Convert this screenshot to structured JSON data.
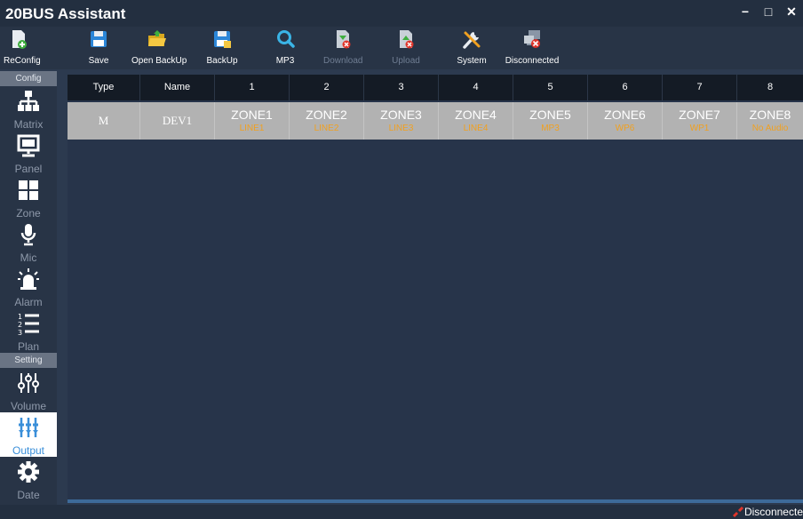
{
  "app": {
    "title": "20BUS Assistant"
  },
  "window": {
    "minimize": "−",
    "maximize": "□",
    "close": "✕"
  },
  "toolbar": {
    "items": [
      {
        "label": "ReConfig",
        "icon": "reconfig-icon",
        "enabled": true
      },
      {
        "label": "Save",
        "icon": "save-icon",
        "enabled": true
      },
      {
        "label": "Open BackUp",
        "icon": "folder-open-icon",
        "enabled": true
      },
      {
        "label": "BackUp",
        "icon": "backup-icon",
        "enabled": true
      },
      {
        "label": "MP3",
        "icon": "search-icon",
        "enabled": true
      },
      {
        "label": "Download",
        "icon": "download-icon",
        "enabled": false
      },
      {
        "label": "Upload",
        "icon": "upload-icon",
        "enabled": false
      },
      {
        "label": "System",
        "icon": "tools-icon",
        "enabled": true
      },
      {
        "label": "Disconnected",
        "icon": "disconnected-icon",
        "enabled": true
      }
    ]
  },
  "sidebar": {
    "config_header": "Config",
    "setting_header": "Setting",
    "items": [
      {
        "label": "Matrix",
        "icon": "matrix-icon"
      },
      {
        "label": "Panel",
        "icon": "panel-icon"
      },
      {
        "label": "Zone",
        "icon": "zone-icon"
      },
      {
        "label": "Mic",
        "icon": "mic-icon"
      },
      {
        "label": "Alarm",
        "icon": "alarm-icon"
      },
      {
        "label": "Plan",
        "icon": "plan-icon"
      },
      {
        "label": "Volume",
        "icon": "volume-icon"
      },
      {
        "label": "Output",
        "icon": "output-icon",
        "active": true
      },
      {
        "label": "Date",
        "icon": "gear-icon"
      }
    ]
  },
  "table": {
    "headers": [
      "Type",
      "Name",
      "1",
      "2",
      "3",
      "4",
      "5",
      "6",
      "7",
      "8"
    ],
    "row": {
      "type": "M",
      "name": "DEV1",
      "zones": [
        {
          "name": "ZONE1",
          "source": "LINE1"
        },
        {
          "name": "ZONE2",
          "source": "LINE2"
        },
        {
          "name": "ZONE3",
          "source": "LINE3"
        },
        {
          "name": "ZONE4",
          "source": "LINE4"
        },
        {
          "name": "ZONE5",
          "source": "MP3"
        },
        {
          "name": "ZONE6",
          "source": "WP6"
        },
        {
          "name": "ZONE7",
          "source": "WP1"
        },
        {
          "name": "ZONE8",
          "source": "No Audio"
        }
      ]
    }
  },
  "status": {
    "text": "Disconnecte"
  },
  "colors": {
    "accent": "#3a8fd9",
    "source_text": "#f0a020",
    "header_bg": "#141b25",
    "row_bg": "#b2b2b2",
    "status_icon": "#e0352b"
  }
}
